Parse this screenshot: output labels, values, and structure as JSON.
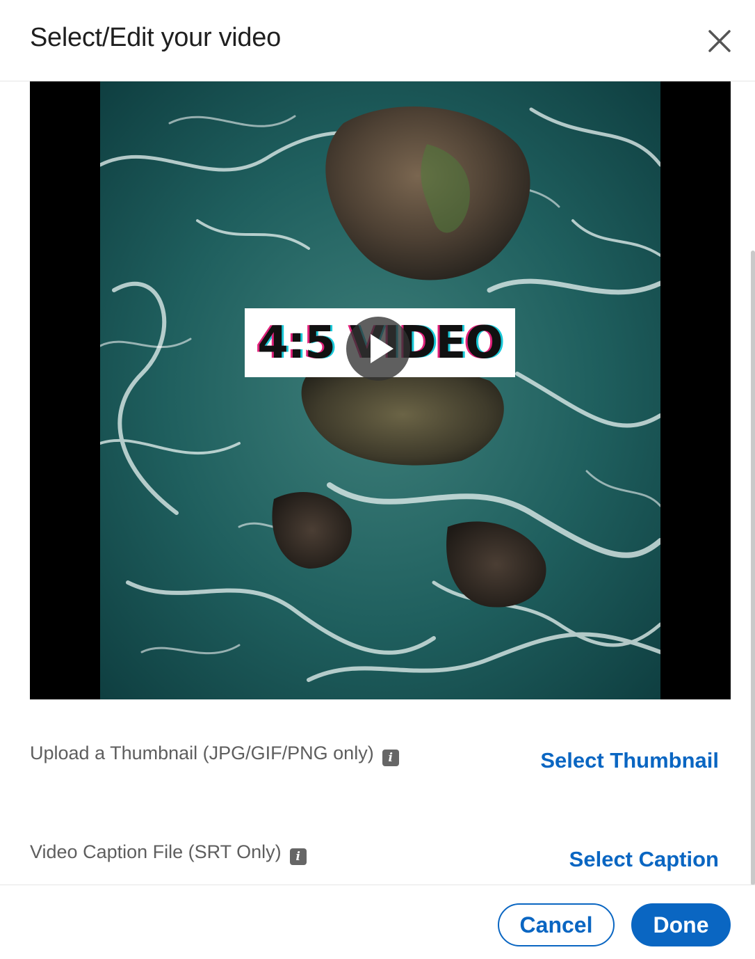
{
  "dialog": {
    "title": "Select/Edit your video",
    "close_icon": "close-icon"
  },
  "video": {
    "overlay_text": "4:5 VIDEO",
    "play_icon": "play-icon"
  },
  "thumbnail": {
    "label": "Upload a Thumbnail (JPG/GIF/PNG only)",
    "info_icon": "info-icon",
    "info_glyph": "i",
    "action": "Select Thumbnail"
  },
  "caption": {
    "label": "Video Caption File (SRT Only)",
    "info_icon": "info-icon",
    "info_glyph": "i",
    "action": "Select Caption"
  },
  "footer": {
    "cancel_label": "Cancel",
    "done_label": "Done"
  },
  "colors": {
    "accent": "#0a66c2",
    "label_text": "#5e5e5e",
    "title_text": "#1f1f1f"
  }
}
